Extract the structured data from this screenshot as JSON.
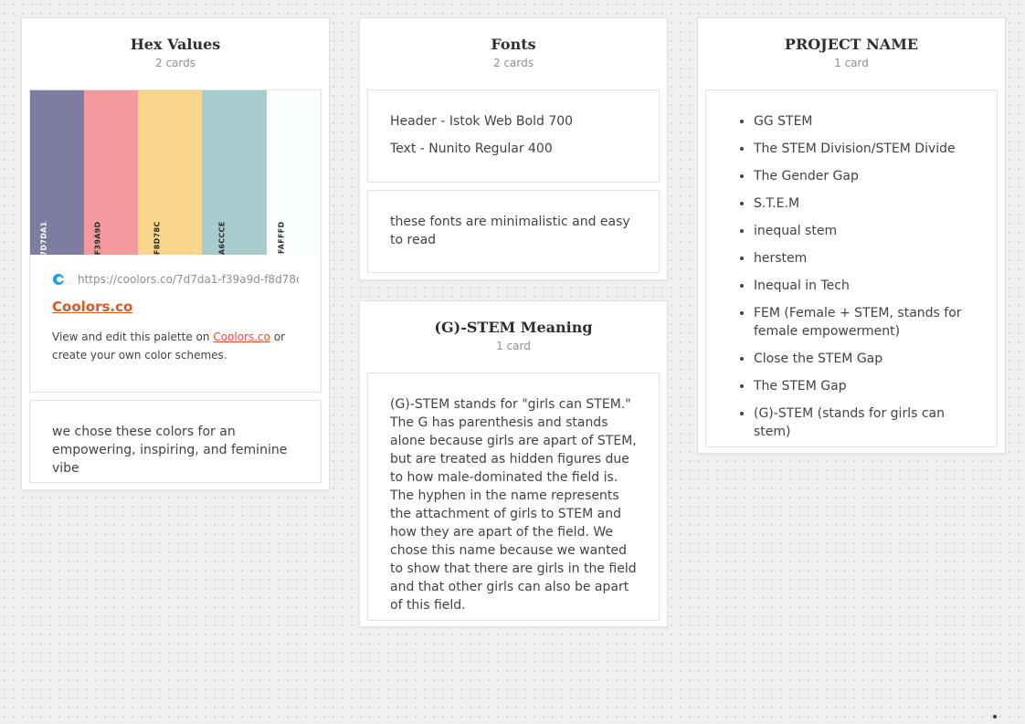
{
  "columns": {
    "hex": {
      "title": "Hex Values",
      "count": "2 cards",
      "palette": [
        {
          "hex": "7D7DA1",
          "color": "#7d7da1",
          "text_color": "#ffffff"
        },
        {
          "hex": "F39A9D",
          "color": "#f39a9d",
          "text_color": "#2b2b2b"
        },
        {
          "hex": "F8D78C",
          "color": "#f8d78c",
          "text_color": "#2b2b2b"
        },
        {
          "hex": "A6CCCE",
          "color": "#a6ccce",
          "text_color": "#2b2b2b"
        },
        {
          "hex": "FAFFFD",
          "color": "#fafffd",
          "text_color": "#2b2b2b"
        }
      ],
      "link": {
        "url": "https://coolors.co/7d7da1-f39a9d-f8d78c-a",
        "title": "Coolors.co",
        "desc_prefix": "View and edit this palette on ",
        "desc_link": "Coolors.co",
        "desc_suffix": " or create your own color schemes."
      },
      "note": "we chose these colors for an empowering, inspiring, and feminine vibe"
    },
    "fonts": {
      "title": "Fonts",
      "count": "2 cards",
      "lines": [
        "Header - Istok Web Bold 700",
        "Text - Nunito Regular 400"
      ],
      "note": "these fonts are minimalistic and easy to read"
    },
    "meaning": {
      "title": "(G)-STEM Meaning",
      "count": "1 card",
      "text": "(G)-STEM stands for \"girls can STEM.\" The G has parenthesis and stands alone because girls are apart of STEM, but are treated as hidden figures due to how male-dominated the field is. The hyphen in the name represents the attachment of girls to STEM and how they are apart of the field. We chose this name because we wanted to show that there are girls in the field and that other girls can also be apart of this field."
    },
    "project": {
      "title": "PROJECT NAME",
      "count": "1 card",
      "items": [
        "GG STEM",
        "The STEM Division/STEM Divide",
        "The Gender Gap",
        "S.T.E.M",
        "inequal stem",
        "herstem",
        "Inequal in Tech",
        "FEM (Female + STEM, stands for female empowerment)",
        "Close the STEM Gap",
        "The STEM Gap",
        "(G)-STEM (stands for girls can stem)"
      ]
    }
  },
  "colors": {
    "accent_link": "#e0561c",
    "coolors_logo": "#0ea5e9"
  }
}
